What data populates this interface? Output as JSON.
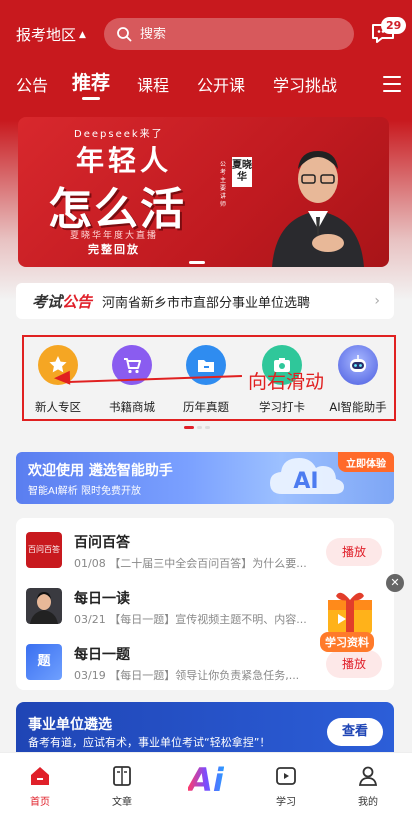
{
  "header": {
    "region_label": "报考地区",
    "search_placeholder": "搜索",
    "message_badge": "29"
  },
  "tabs": [
    {
      "label": "公告"
    },
    {
      "label": "推荐",
      "active": true
    },
    {
      "label": "课程"
    },
    {
      "label": "公开课"
    },
    {
      "label": "学习挑战"
    }
  ],
  "banner": {
    "top": "Deepseek来了",
    "line1": "年轻人",
    "line2": "怎么活",
    "subtitle": "夏晓华年度大直播",
    "replay": "完整回放",
    "name": "夏晓华",
    "role": "公考主要讲师"
  },
  "notice": {
    "tag_a": "考试",
    "tag_b": "公告",
    "text": "河南省新乡市市直部分事业单位选聘"
  },
  "quick_icons": [
    {
      "label": "新人专区",
      "icon": "star-badge-icon",
      "color": "#f5a623"
    },
    {
      "label": "书籍商城",
      "icon": "cart-icon",
      "color": "#8a5cf0"
    },
    {
      "label": "历年真题",
      "icon": "folder-icon",
      "color": "#2f8cf0"
    },
    {
      "label": "学习打卡",
      "icon": "camera-icon",
      "color": "#2fc79a"
    },
    {
      "label": "AI智能助手",
      "icon": "robot-icon",
      "color": "#6a7cf5"
    }
  ],
  "annotation": {
    "swipe_text": "向右滑动"
  },
  "ai_promo": {
    "title": "欢迎使用 遴选智能助手",
    "subtitle": "智能AI解析 限时免费开放",
    "cloud_text": "AI",
    "try_label": "立即体验"
  },
  "list_items": [
    {
      "title": "百问百答",
      "desc": "01/08 【二十届三中全会百问百答】为什么要...",
      "thumb_text": "百问百答",
      "action": "播放"
    },
    {
      "title": "每日一读",
      "desc": "03/21 【每日一题】宣传视频主题不明、内容...",
      "thumb_text": "",
      "action": ""
    },
    {
      "title": "每日一题",
      "desc": "03/19 【每日一题】领导让你负责紧急任务,...",
      "thumb_text": "题",
      "action": "播放"
    }
  ],
  "float_widget": {
    "label": "学习资料"
  },
  "institution": {
    "title": "事业单位遴选",
    "subtitle": "备考有道，应试有术，事业单位考试“轻松拿捏”！",
    "button": "查看"
  },
  "bottom_nav": [
    {
      "label": "首页",
      "active": true
    },
    {
      "label": "文章"
    },
    {
      "label": "",
      "center": "Ai"
    },
    {
      "label": "学习"
    },
    {
      "label": "我的"
    }
  ],
  "colors": {
    "brand_red": "#c8191e",
    "accent_red": "#e0202a"
  }
}
